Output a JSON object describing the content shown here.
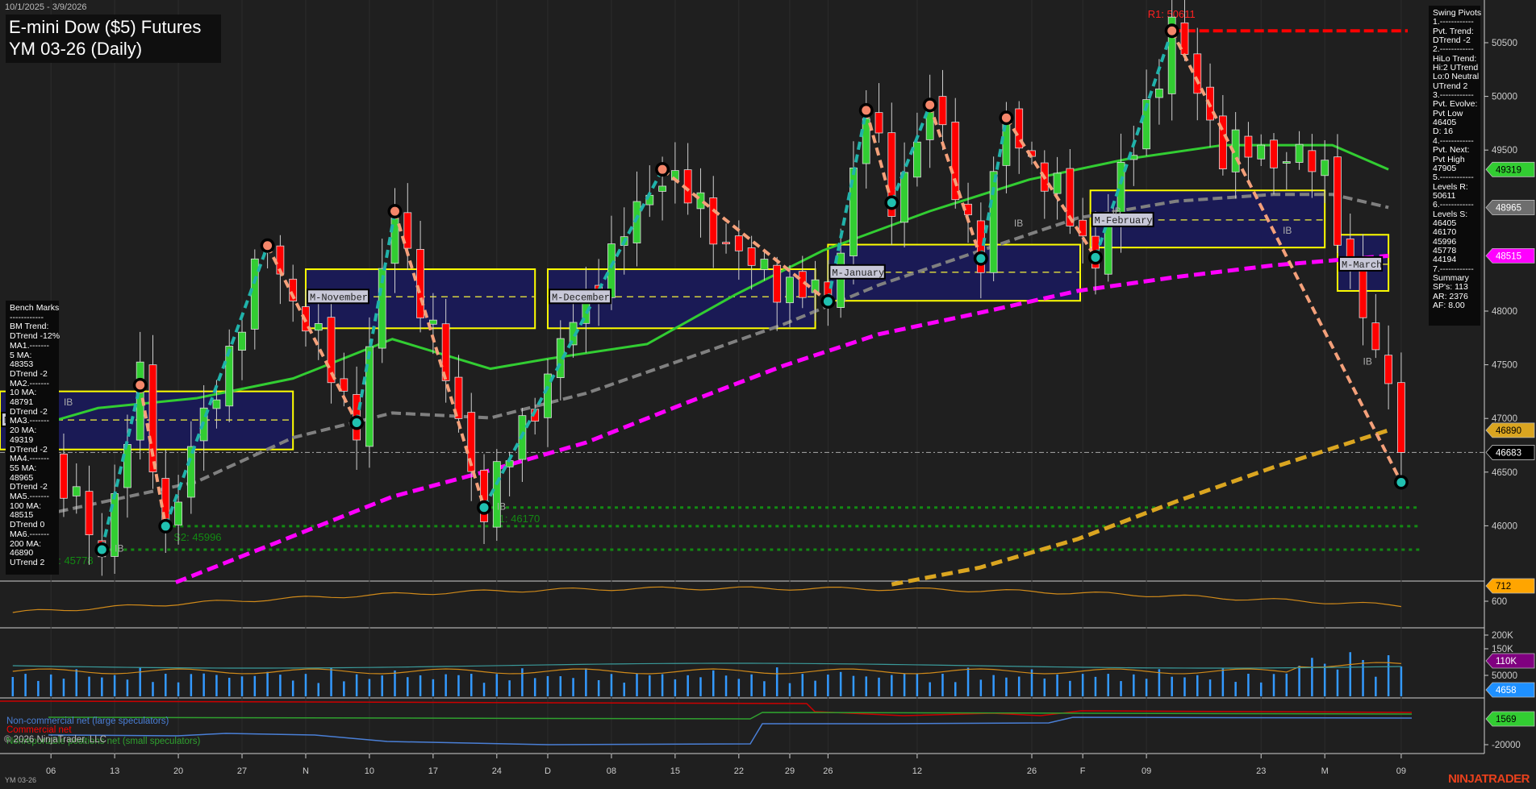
{
  "header": {
    "date_range": "10/1/2025 - 3/9/2026",
    "title_line1": "E-mini Dow ($5) Futures",
    "title_line2": "YM 03-26 (Daily)"
  },
  "bench_marks": {
    "lines": [
      "Bench Marks",
      "------------",
      "BM Trend:",
      "DTrend -12%",
      "MA1.-------",
      "5 MA:",
      "48353",
      "DTrend -2",
      "MA2.-------",
      "10 MA:",
      "48791",
      "DTrend -2",
      "MA3.-------",
      "20 MA:",
      "49319",
      "DTrend -2",
      "MA4.-------",
      "55 MA:",
      "48965",
      "DTrend -2",
      "MA5.-------",
      "100 MA:",
      "48515",
      "DTrend 0",
      "MA6.-------",
      "200 MA:",
      "46890",
      "UTrend 2"
    ]
  },
  "swing_pivots_panel": {
    "lines": [
      "Swing Pivots",
      "1.------------",
      "Pvt. Trend:",
      "DTrend -2",
      "2.------------",
      "HiLo Trend:",
      "Hi:2 UTrend",
      "Lo:0 Neutral",
      "UTrend 2",
      "3.------------",
      "Pvt. Evolve:",
      "Pvt Low",
      "46405",
      "D: 16",
      "4.------------",
      "Pvt. Next:",
      "Pvt High",
      "47905",
      "5.------------",
      "Levels R:",
      "50611",
      "6.------------",
      "Levels S:",
      "46405",
      "46170",
      "45996",
      "45778",
      "44194",
      "7.------------",
      "Summary",
      "SP's: 113",
      "AR: 2376",
      "AF: 8.00"
    ]
  },
  "price_axis": {
    "ticks": [
      50500,
      50000,
      49500,
      48000,
      47500,
      47000,
      46500,
      46000
    ],
    "labels": [
      "50500",
      "50000",
      "49500",
      "48000",
      "47500",
      "47000",
      "46500",
      "46000"
    ]
  },
  "sub_axes": {
    "range_panel": [
      "600"
    ],
    "volume_panel": [
      "200K",
      "150K",
      "50000"
    ],
    "cot_panel": [
      "-20000"
    ]
  },
  "axis_markers": [
    {
      "panel": "main",
      "value": 49319,
      "label": "49319",
      "bg": "#32cd32",
      "fg": "#000000"
    },
    {
      "panel": "main",
      "value": 48965,
      "label": "48965",
      "bg": "#6e6e6e",
      "fg": "#ffffff"
    },
    {
      "panel": "main",
      "value": 48515,
      "label": "48515",
      "bg": "#ff00ff",
      "fg": "#ffffff"
    },
    {
      "panel": "main",
      "value": 46890,
      "label": "46890",
      "bg": "#daa520",
      "fg": "#000000"
    },
    {
      "panel": "main",
      "value": 46683,
      "label": "46683",
      "bg": "#000000",
      "fg": "#ffffff"
    },
    {
      "panel": "range",
      "value": 712,
      "label": "712",
      "bg": "#ffa500",
      "fg": "#000000"
    },
    {
      "panel": "volume",
      "value": 110000,
      "label": "110K",
      "bg": "#800080",
      "fg": "#ffffff"
    },
    {
      "panel": "volume",
      "value": 4658,
      "label": "4658",
      "bg": "#1e90ff",
      "fg": "#ffffff"
    },
    {
      "panel": "cot",
      "value": 1569,
      "label": "1569",
      "bg": "#32cd32",
      "fg": "#000000"
    }
  ],
  "date_axis": {
    "labels": [
      "06",
      "13",
      "20",
      "27",
      "N",
      "10",
      "17",
      "24",
      "D",
      "08",
      "15",
      "22",
      "29",
      "26",
      "12",
      "26",
      "F",
      "09",
      "23",
      "M",
      "09"
    ],
    "day_index": [
      3,
      8,
      13,
      18,
      23,
      28,
      33,
      38,
      42,
      47,
      52,
      57,
      61,
      64,
      71,
      80,
      84,
      89,
      98,
      103,
      109
    ]
  },
  "levels": {
    "resistance": [
      {
        "label": "R1: 50611",
        "value": 50611,
        "from_day": 91
      }
    ],
    "support": [
      {
        "label": "S1: 46170",
        "value": 46170,
        "from_day": 37
      },
      {
        "label": "S2: 45996",
        "value": 45996,
        "from_day": 12
      },
      {
        "label": "S3: 45778",
        "value": 45778,
        "from_day": 7
      }
    ],
    "last_price": 46683
  },
  "monthly_boxes": [
    {
      "label": "M-October",
      "from_day": -1,
      "to_day": 22,
      "high": 47252,
      "low": 46711,
      "mid": 46986
    },
    {
      "label": "M-November",
      "from_day": 23,
      "to_day": 41,
      "high": 48390,
      "low": 47840,
      "mid": 48133
    },
    {
      "label": "M-December",
      "from_day": 42,
      "to_day": 63,
      "high": 48390,
      "low": 47840,
      "mid": 48133
    },
    {
      "label": "M-January",
      "from_day": 64,
      "to_day": 83.8,
      "high": 48619,
      "low": 48096,
      "mid": 48362
    },
    {
      "label": "M-February",
      "from_day": 84.6,
      "to_day": 103,
      "high": 49124,
      "low": 48592,
      "mid": 48849
    },
    {
      "label": "M-March",
      "from_day": 104,
      "to_day": 108,
      "high": 48711,
      "low": 48188,
      "mid": 48436
    }
  ],
  "ib_labels": [
    {
      "text": "IB",
      "day": 4,
      "price": 47120
    },
    {
      "text": "IB",
      "day": 8,
      "price": 45760
    },
    {
      "text": "IB",
      "day": 38,
      "price": 46150
    },
    {
      "text": "IB",
      "day": 78.6,
      "price": 48790
    },
    {
      "text": "IB",
      "day": 86.3,
      "price": 48900
    },
    {
      "text": "IB",
      "day": 99.7,
      "price": 48720
    },
    {
      "text": "IB",
      "day": 106,
      "price": 47500
    }
  ],
  "legend": {
    "noncommercial": "Non-commercial net (large speculators)",
    "commercial": "Commercial net",
    "nonreportable": "Nonreportable positions net (small speculators)",
    "copyright": "© 2026 NinjaTrader, LLC"
  },
  "footer": {
    "instrument": "YM 03-26",
    "brand": "NINJATRADER"
  },
  "chart_data": {
    "type": "candlestick",
    "title": "E-mini Dow ($5) Futures YM 03-26 (Daily)",
    "ylim": [
      45600,
      50750
    ],
    "price_path": [
      [
        0,
        47100
      ],
      [
        7,
        45790
      ],
      [
        10,
        47310
      ],
      [
        12,
        46000
      ],
      [
        20,
        48610
      ],
      [
        27,
        46960
      ],
      [
        30,
        48930
      ],
      [
        37,
        46170
      ],
      [
        44,
        47900
      ],
      [
        51,
        49320
      ],
      [
        58,
        48400
      ],
      [
        64,
        48090
      ],
      [
        67,
        49870
      ],
      [
        69,
        49010
      ],
      [
        72,
        49920
      ],
      [
        76,
        48490
      ],
      [
        78,
        49800
      ],
      [
        85,
        48500
      ],
      [
        91,
        50611
      ],
      [
        95,
        49500
      ],
      [
        100,
        49450
      ],
      [
        103,
        49300
      ],
      [
        106,
        47900
      ],
      [
        108,
        47300
      ],
      [
        109,
        46683
      ]
    ],
    "swing_pivots": [
      {
        "day": 7,
        "price": 45778,
        "type": "low"
      },
      {
        "day": 10,
        "price": 47310,
        "type": "high"
      },
      {
        "day": 12,
        "price": 45996,
        "type": "low"
      },
      {
        "day": 20,
        "price": 48610,
        "type": "high"
      },
      {
        "day": 27,
        "price": 46960,
        "type": "low"
      },
      {
        "day": 30,
        "price": 48930,
        "type": "high"
      },
      {
        "day": 37,
        "price": 46170,
        "type": "low"
      },
      {
        "day": 51,
        "price": 49320,
        "type": "high"
      },
      {
        "day": 64,
        "price": 48090,
        "type": "low"
      },
      {
        "day": 67,
        "price": 49870,
        "type": "high"
      },
      {
        "day": 69,
        "price": 49010,
        "type": "low"
      },
      {
        "day": 72,
        "price": 49920,
        "type": "high"
      },
      {
        "day": 76,
        "price": 48490,
        "type": "low"
      },
      {
        "day": 78,
        "price": 49800,
        "type": "high"
      },
      {
        "day": 85,
        "price": 48500,
        "type": "low"
      },
      {
        "day": 91,
        "price": 50611,
        "type": "high"
      },
      {
        "day": 109,
        "price": 46405,
        "type": "low"
      }
    ],
    "ma20": [
      [
        0,
        46867
      ],
      [
        6.7,
        47097
      ],
      [
        14.4,
        47188
      ],
      [
        22,
        47372
      ],
      [
        29.8,
        47739
      ],
      [
        37.5,
        47463
      ],
      [
        42,
        47555
      ],
      [
        49.8,
        47693
      ],
      [
        56.7,
        48151
      ],
      [
        63.6,
        48564
      ],
      [
        72,
        48931
      ],
      [
        79.8,
        49225
      ],
      [
        87.5,
        49417
      ],
      [
        95,
        49546
      ],
      [
        103.6,
        49546
      ],
      [
        108,
        49319
      ]
    ],
    "ma55": [
      [
        3.6,
        46133
      ],
      [
        14.4,
        46408
      ],
      [
        22,
        46821
      ],
      [
        29.8,
        47051
      ],
      [
        37.5,
        47005
      ],
      [
        45,
        47234
      ],
      [
        52.8,
        47555
      ],
      [
        60.5,
        47876
      ],
      [
        68,
        48243
      ],
      [
        76,
        48564
      ],
      [
        83.6,
        48867
      ],
      [
        91.3,
        49023
      ],
      [
        99,
        49087
      ],
      [
        103.6,
        49087
      ],
      [
        108,
        48965
      ]
    ],
    "ma100": [
      [
        12.8,
        45473
      ],
      [
        22,
        45904
      ],
      [
        29.8,
        46271
      ],
      [
        37.5,
        46518
      ],
      [
        45,
        46775
      ],
      [
        52.8,
        47142
      ],
      [
        60.5,
        47491
      ],
      [
        68,
        47785
      ],
      [
        76,
        47986
      ],
      [
        83.6,
        48188
      ],
      [
        91.3,
        48317
      ],
      [
        99,
        48427
      ],
      [
        108,
        48515
      ]
    ],
    "ma200": [
      [
        69,
        45454
      ],
      [
        75.9,
        45610
      ],
      [
        83.6,
        45876
      ],
      [
        91.3,
        46225
      ],
      [
        99,
        46546
      ],
      [
        108,
        46890
      ]
    ],
    "colors": {
      "up": "#32cd32",
      "down": "#ff0000",
      "ma20": "#32cd32",
      "ma55": "#808080",
      "ma100": "#ff00ff",
      "ma200": "#daa520",
      "pivot_up_leg": "#20b2aa",
      "pivot_down_leg": "#f4a07a"
    }
  }
}
